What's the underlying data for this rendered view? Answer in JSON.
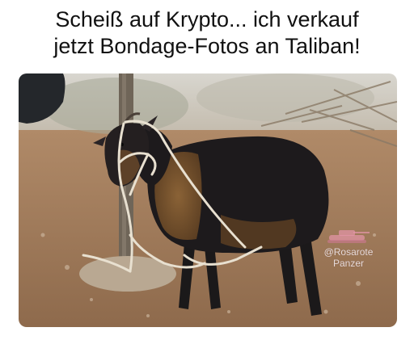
{
  "meme": {
    "caption_line1": "Scheiß auf Krypto... ich verkauf",
    "caption_line2": "jetzt Bondage-Fotos an Taliban!",
    "watermark_line1": "@Rosarote",
    "watermark_line2": "Panzer"
  },
  "colors": {
    "ground": "#a07a5a",
    "goat_black": "#1d1a1c",
    "goat_tan": "#7a5430",
    "rope": "#e8e0d0",
    "background_haze": "#c9c6bd"
  }
}
